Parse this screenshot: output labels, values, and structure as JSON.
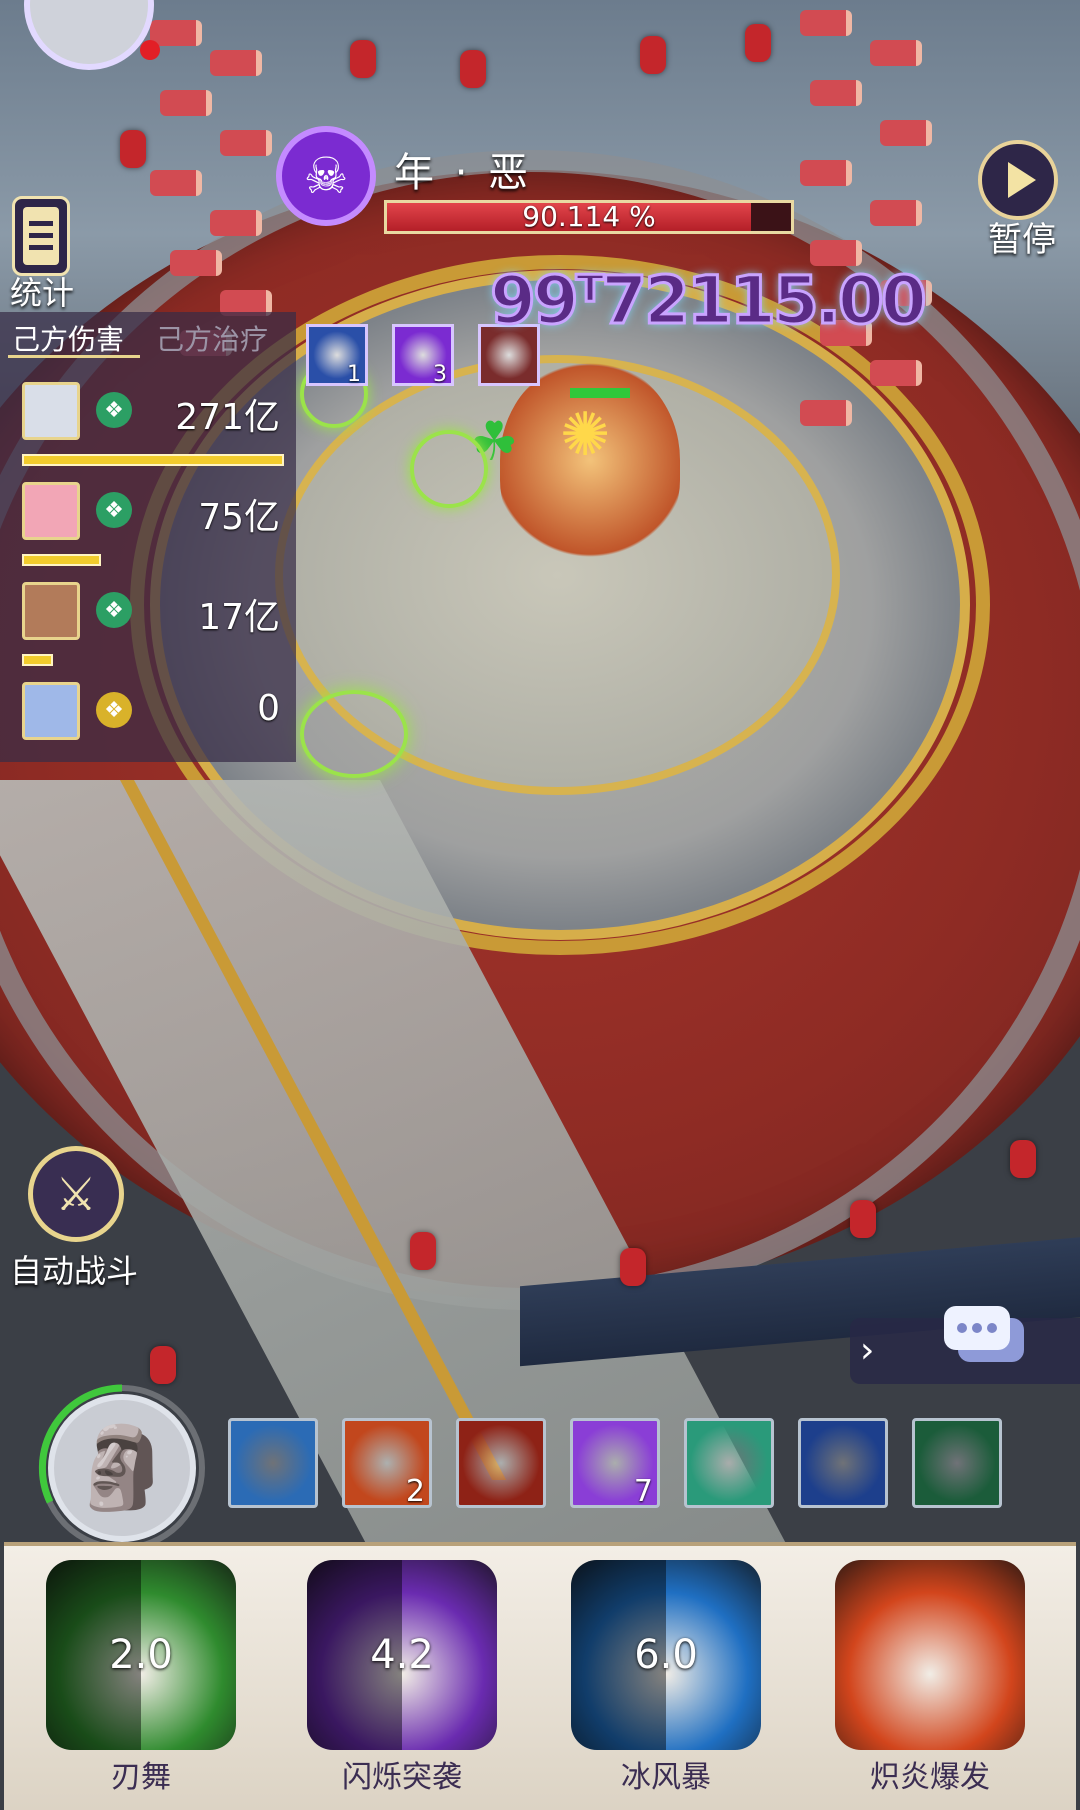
{
  "boss": {
    "name": "年 · 恶",
    "hp_text": "90.114 %",
    "hp_percent": 90.114,
    "skull_icon": "skull-icon"
  },
  "controls": {
    "pause_label": "暂停",
    "stats_label": "统计",
    "auto_battle_label": "自动战斗"
  },
  "stats": {
    "tabs": [
      "己方伤害",
      "己方治疗"
    ],
    "active_tab": 0,
    "rows": [
      {
        "value": "271亿",
        "bar_fraction": 1.0,
        "avatar_color": "#d9dee8",
        "badge_color": "#2c9f64"
      },
      {
        "value": "75亿",
        "bar_fraction": 0.3,
        "avatar_color": "#f2a6b6",
        "badge_color": "#2c9f64"
      },
      {
        "value": "17亿",
        "bar_fraction": 0.12,
        "avatar_color": "#b27b5a",
        "badge_color": "#2c9f64"
      },
      {
        "value": "0",
        "bar_fraction": 0.0,
        "avatar_color": "#9fb8e8",
        "badge_color": "#d9b22a"
      }
    ]
  },
  "boss_buffs": [
    {
      "icon": "galaxy-icon",
      "count": "1",
      "color": "#2a4fa8"
    },
    {
      "icon": "dark-lotus-icon",
      "count": "3",
      "color": "#7b2bd1"
    },
    {
      "icon": "meteor-icon",
      "count": "",
      "color": "#7a2c2c"
    }
  ],
  "damage_popup": "99ᵀ72115.00",
  "skill_queue": [
    {
      "icon": "sword-strike-icon",
      "count": "",
      "color": "#2b6bb5"
    },
    {
      "icon": "fire-figure-icon",
      "count": "2",
      "color": "#c2471d"
    },
    {
      "icon": "flame-silhouette-icon",
      "count": "",
      "color": "#8e2216"
    },
    {
      "icon": "sun-face-icon",
      "count": "7",
      "color": "#8a3ed6"
    },
    {
      "icon": "green-barrier-icon",
      "count": "",
      "color": "#2a9a7a"
    },
    {
      "icon": "lightning-figure-icon",
      "count": "",
      "color": "#1d3f8c"
    },
    {
      "icon": "green-dash-icon",
      "count": "",
      "color": "#1b5c3a"
    },
    {
      "icon": "blue-burst-icon",
      "count": "",
      "color": "#1f3aa8"
    }
  ],
  "main_skills": [
    {
      "label": "刃舞",
      "cooldown": "2.0",
      "icon": "blade-dance-icon",
      "color": "#2f8b2e",
      "cd_fraction": 0.5
    },
    {
      "label": "闪烁突袭",
      "cooldown": "4.2",
      "icon": "blink-strike-icon",
      "color": "#6a2bb0",
      "cd_fraction": 0.5
    },
    {
      "label": "冰风暴",
      "cooldown": "6.0",
      "icon": "ice-storm-icon",
      "color": "#1f6fc2",
      "cd_fraction": 0.5
    },
    {
      "label": "炽炎爆发",
      "cooldown": "",
      "icon": "blaze-burst-icon",
      "color": "#d2451c",
      "cd_fraction": 0
    }
  ],
  "colors": {
    "hp_fill": "#c9242e",
    "accent_gold": "#e8d48d",
    "panel_purple": "#2e2648"
  }
}
